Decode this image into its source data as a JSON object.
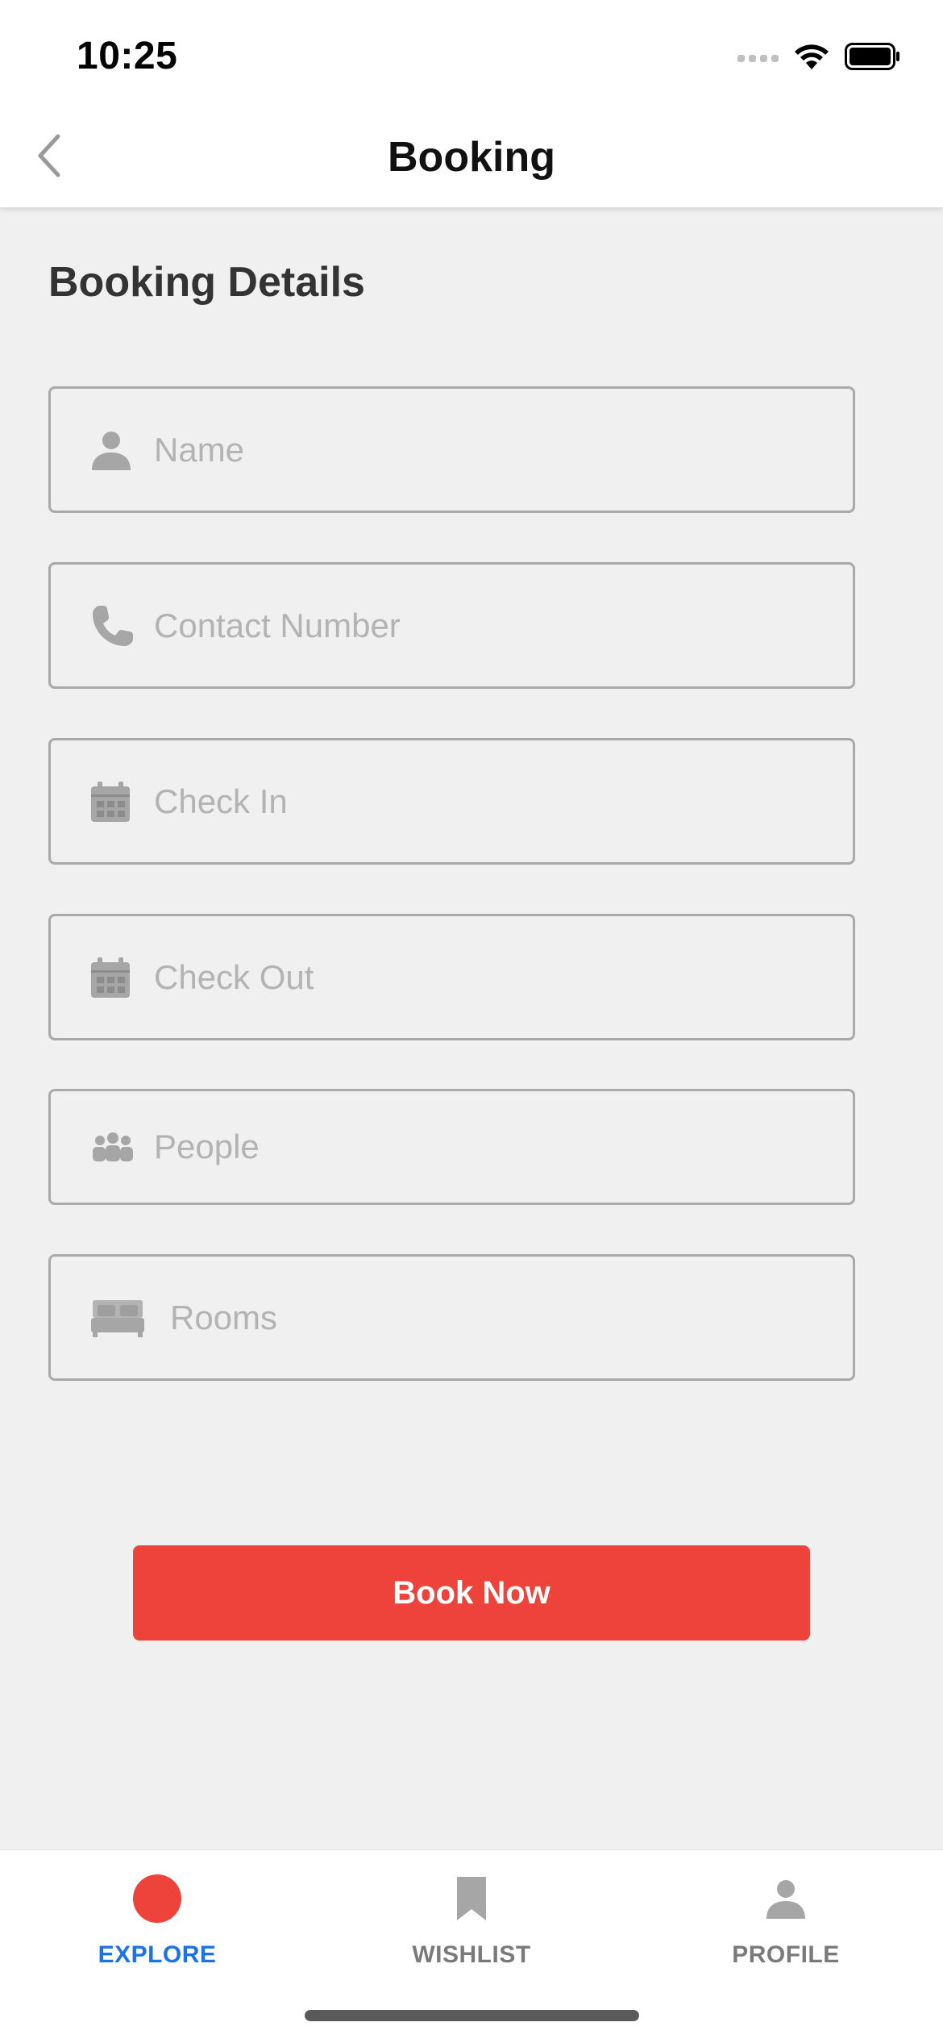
{
  "status_bar": {
    "time": "10:25"
  },
  "header": {
    "title": "Booking",
    "back_icon": "chevron-left-icon"
  },
  "section": {
    "title": "Booking Details"
  },
  "form": {
    "fields": [
      {
        "id": "name",
        "icon": "person-icon",
        "placeholder": "Name",
        "value": ""
      },
      {
        "id": "contact",
        "icon": "phone-icon",
        "placeholder": "Contact Number",
        "value": ""
      },
      {
        "id": "checkin",
        "icon": "calendar-icon",
        "placeholder": "Check In",
        "value": ""
      },
      {
        "id": "checkout",
        "icon": "calendar-icon",
        "placeholder": "Check Out",
        "value": ""
      },
      {
        "id": "people",
        "icon": "group-icon",
        "placeholder": "People",
        "value": ""
      },
      {
        "id": "rooms",
        "icon": "bed-icon",
        "placeholder": "Rooms",
        "value": ""
      }
    ],
    "submit_label": "Book Now"
  },
  "tabs": [
    {
      "label": "EXPLORE",
      "icon": "explore-dot-icon",
      "active": true
    },
    {
      "label": "WISHLIST",
      "icon": "bookmark-icon",
      "active": false
    },
    {
      "label": "PROFILE",
      "icon": "person-icon",
      "active": false
    }
  ],
  "colors": {
    "accent": "#ee433b",
    "active_tab": "#1a73e8",
    "inactive_tab": "#7a7a7a",
    "background": "#f0f0f0"
  }
}
